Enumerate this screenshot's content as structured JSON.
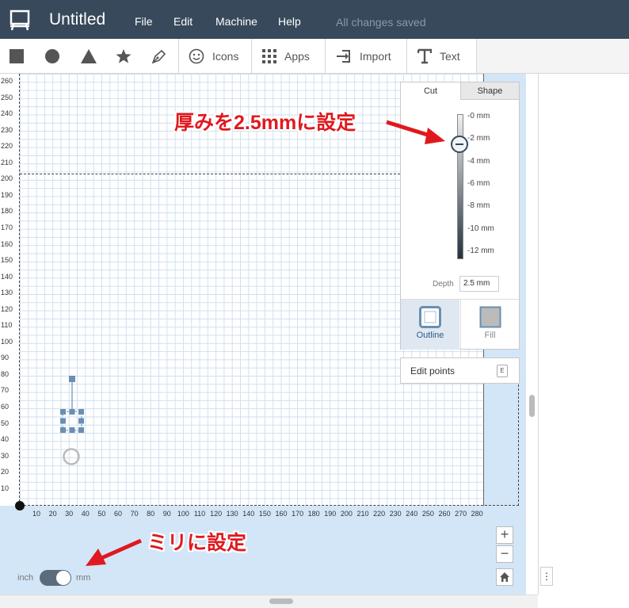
{
  "app": {
    "title": "Untitled",
    "menu": [
      "File",
      "Edit",
      "Machine",
      "Help"
    ],
    "status": "All changes saved"
  },
  "toolbar": {
    "shapes": [
      "square-icon",
      "circle-icon",
      "triangle-icon",
      "star-icon",
      "pen-icon"
    ],
    "icons_label": "Icons",
    "apps_label": "Apps",
    "import_label": "Import",
    "text_label": "Text"
  },
  "ruler": {
    "y_labels": [
      "260",
      "250",
      "240",
      "230",
      "220",
      "210",
      "200",
      "190",
      "180",
      "170",
      "160",
      "150",
      "140",
      "130",
      "120",
      "110",
      "100",
      "90",
      "80",
      "70",
      "60",
      "50",
      "40",
      "30",
      "20",
      "10"
    ],
    "x_labels": [
      "10",
      "20",
      "30",
      "40",
      "50",
      "60",
      "70",
      "80",
      "90",
      "100",
      "110",
      "120",
      "130",
      "140",
      "150",
      "160",
      "170",
      "180",
      "190",
      "200",
      "210",
      "220",
      "230",
      "240",
      "250",
      "260",
      "270",
      "280"
    ]
  },
  "panel": {
    "tabs": [
      "Cut",
      "Shape"
    ],
    "active_tab": "Cut",
    "depth_ticks": [
      "-0 mm",
      "-2 mm",
      "-4 mm",
      "-6 mm",
      "-8 mm",
      "-10 mm",
      "-12 mm"
    ],
    "depth_label": "Depth",
    "depth_value": "2.5 mm",
    "slider_fraction": 0.208,
    "styles": {
      "outline": "Outline",
      "fill": "Fill"
    },
    "active_style": "Outline",
    "edit_points": "Edit points",
    "edit_points_key": "E"
  },
  "units": {
    "inch": "inch",
    "mm": "mm",
    "selected": "mm"
  },
  "zoom": {
    "in": "+",
    "out": "−"
  },
  "annotations": {
    "thickness": "厚みを2.5mmに設定",
    "mm": "ミリに設定"
  },
  "colors": {
    "topbar": "#37495b",
    "canvas_bg": "#d3e6f7",
    "annotation": "#e0191f",
    "selection": "#6a8fb2"
  }
}
